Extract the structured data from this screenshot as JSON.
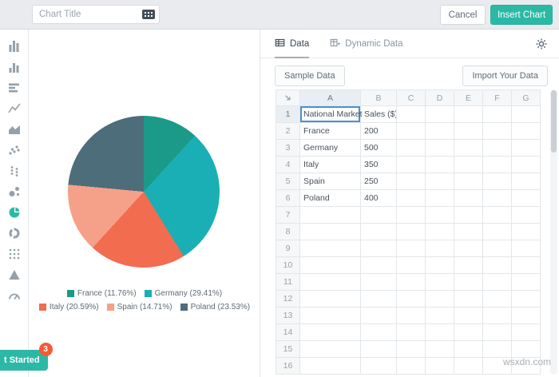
{
  "topbar": {
    "title_placeholder": "Chart Title",
    "cancel_label": "Cancel",
    "insert_label": "Insert Chart"
  },
  "sidebar": {
    "selected": "pie-chart",
    "icons": [
      "histogram",
      "column-chart",
      "horizontal-bar-chart",
      "line-chart",
      "area-chart",
      "scatter-plot",
      "dot-plot",
      "bubble-chart",
      "pie-chart",
      "donut-chart",
      "dot-matrix",
      "pyramid-chart",
      "gauge-chart"
    ]
  },
  "panel": {
    "tabs": [
      {
        "label": "Data"
      },
      {
        "label": "Dynamic Data"
      }
    ],
    "sample_data_label": "Sample Data",
    "import_label": "Import Your Data"
  },
  "spreadsheet": {
    "columns": [
      "A",
      "B",
      "C",
      "D",
      "E",
      "F",
      "G"
    ],
    "row_count": 16,
    "selected": "A1",
    "cells": {
      "A1": "National Market",
      "B1": "Sales ($)",
      "A2": "France",
      "B2": "200",
      "A3": "Germany",
      "B3": "500",
      "A4": "Italy",
      "B4": "350",
      "A5": "Spain",
      "B5": "250",
      "A6": "Poland",
      "B6": "400"
    }
  },
  "chart_data": {
    "type": "pie",
    "labels": [
      "France",
      "Germany",
      "Italy",
      "Spain",
      "Poland"
    ],
    "values": [
      200,
      500,
      350,
      250,
      400
    ],
    "percentages": [
      11.76,
      29.41,
      20.59,
      14.71,
      23.53
    ],
    "colors": [
      "#1b9a89",
      "#1aafb4",
      "#f26c50",
      "#f5a189",
      "#4e6d7b"
    ],
    "legend_labels": [
      "France (11.76%)",
      "Germany (29.41%)",
      "Italy (20.59%)",
      "Spain (14.71%)",
      "Poland (23.53%)"
    ],
    "legend_position": "bottom"
  },
  "footer": {
    "get_started_label": "t Started",
    "badge": "3"
  },
  "watermark": "wsxdn.com"
}
